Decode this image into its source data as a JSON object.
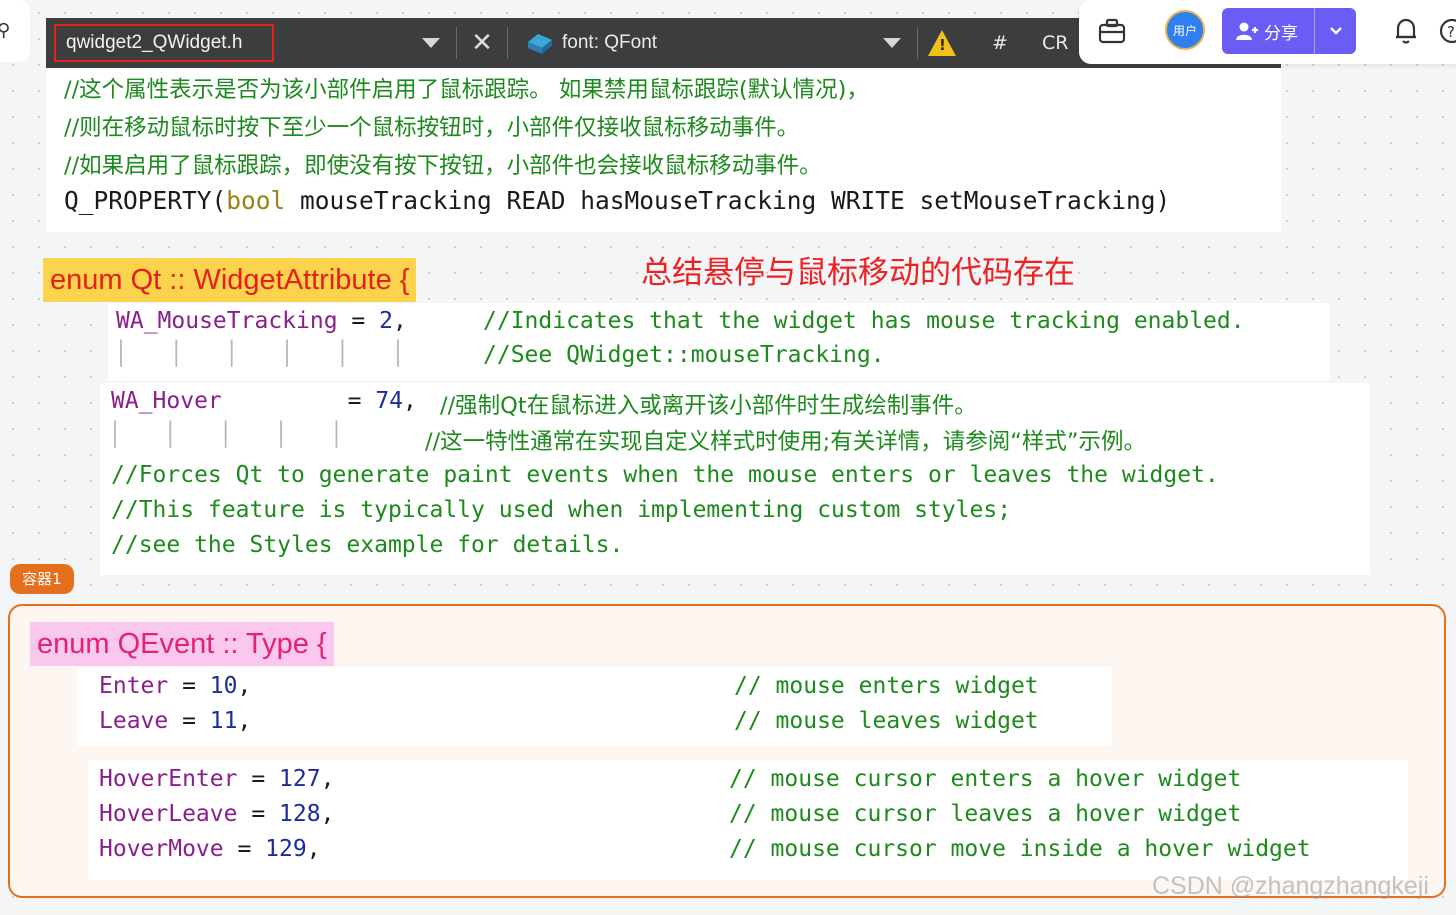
{
  "toolbar": {
    "file_name": "qwidget2_QWidget.h",
    "symbol_label": "font: QFont",
    "hash_label": "#",
    "cr_label": "CR"
  },
  "app_bar": {
    "avatar_label": "用户",
    "share_label": "分享"
  },
  "property_block": {
    "comments": [
      "//这个属性表示是否为该小部件启用了鼠标跟踪。 如果禁用鼠标跟踪(默认情况)，",
      "//则在移动鼠标时按下至少一个鼠标按钮时，小部件仅接收鼠标移动事件。",
      "//如果启用了鼠标跟踪，即使没有按下按钮，小部件也会接收鼠标移动事件。"
    ],
    "macro": "Q_PROPERTY(",
    "type": "bool",
    "rest": " mouseTracking READ hasMouseTracking WRITE setMouseTracking)"
  },
  "widget_attribute": {
    "title": "enum Qt :: WidgetAttribute {",
    "note": "总结悬停与鼠标移动的代码存在",
    "mouse_tracking": {
      "name": "WA_MouseTracking",
      "op": " = ",
      "value": "2",
      "sep": ",",
      "comment1": "//Indicates that the widget has mouse tracking enabled.",
      "guides": "│   │   │   │   │   │",
      "comment2": "//See QWidget::mouseTracking."
    },
    "hover": {
      "name": "WA_Hover",
      "op": " = ",
      "value": "74",
      "sep": ",",
      "comment_cn1": "//强制Qt在鼠标进入或离开该小部件时生成绘制事件。",
      "guides": "│   │   │   │   │",
      "comment_cn2": "//这一特性通常在实现自定义样式时使用;有关详情，请参阅“样式”示例。",
      "comments_en": [
        "//Forces Qt to generate paint events when the mouse enters or leaves the widget.",
        "//This feature is typically used when implementing custom styles;",
        "//see the Styles example for details."
      ]
    }
  },
  "container": {
    "tag": "容器1",
    "title": "enum QEvent :: Type {",
    "enter_leave": [
      {
        "name": "Enter",
        "op": " = ",
        "value": "10",
        "sep": ",",
        "comment": "// mouse enters widget"
      },
      {
        "name": "Leave",
        "op": " = ",
        "value": "11",
        "sep": ",",
        "comment": "// mouse leaves widget"
      }
    ],
    "hover_events": [
      {
        "name": "HoverEnter",
        "op": " = ",
        "value": "127",
        "sep": ",",
        "comment": "// mouse cursor enters a hover widget"
      },
      {
        "name": "HoverLeave",
        "op": " = ",
        "value": "128",
        "sep": ",",
        "comment": "// mouse cursor leaves a hover widget"
      },
      {
        "name": "HoverMove",
        "op": " = ",
        "value": "129",
        "sep": ",",
        "comment": "// mouse cursor move inside a hover widget"
      }
    ]
  },
  "watermark": "CSDN @zhangzhangkeji",
  "colors": {
    "comment": "#1d8a1d",
    "enum_name": "#8a1e8a",
    "number": "#1c2c9c",
    "keyword": "#9a8218",
    "highlight_yellow": "#fcd34d",
    "highlight_pink": "#f9c8ec",
    "container_border": "#e4701e",
    "note_red": "#ee2020",
    "share_button": "#6b5cf5"
  }
}
